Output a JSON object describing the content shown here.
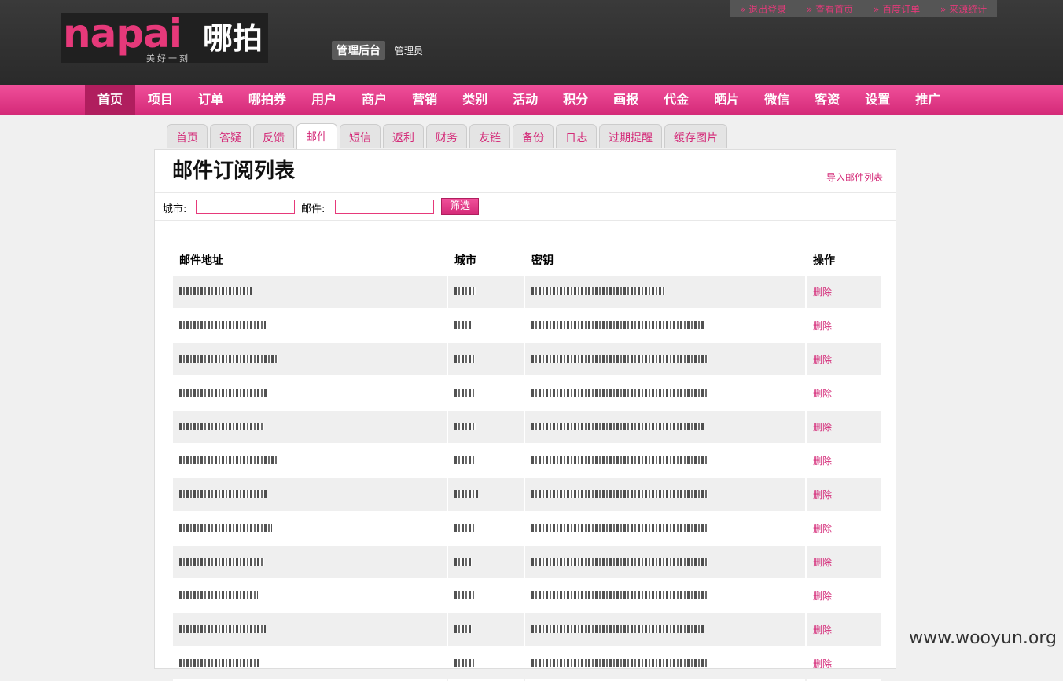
{
  "logo": {
    "text": "napai",
    "cn": "哪拍",
    "slogan": "美好一刻"
  },
  "header": {
    "badge": "管理后台",
    "user": "管理员"
  },
  "toplinks": [
    "» 退出登录",
    "» 查看首页",
    "» 百度订单",
    "» 来源统计"
  ],
  "nav": [
    "首页",
    "项目",
    "订单",
    "哪拍券",
    "用户",
    "商户",
    "营销",
    "类别",
    "活动",
    "积分",
    "画报",
    "代金",
    "晒片",
    "微信",
    "客资",
    "设置",
    "推广"
  ],
  "nav_active": 0,
  "subtabs": [
    "首页",
    "答疑",
    "反馈",
    "邮件",
    "短信",
    "返利",
    "财务",
    "友链",
    "备份",
    "日志",
    "过期提醒",
    "缓存图片"
  ],
  "subtab_active": 3,
  "page": {
    "title": "邮件订阅列表",
    "import_link": "导入邮件列表"
  },
  "filter": {
    "city_label": "城市:",
    "email_label": "邮件:",
    "button": "筛选"
  },
  "table": {
    "headers": [
      "邮件地址",
      "城市",
      "密钥",
      "操作"
    ],
    "rows": [
      {
        "action": "删除"
      },
      {
        "action": "删除"
      },
      {
        "action": "删除"
      },
      {
        "action": "删除"
      },
      {
        "action": "删除"
      },
      {
        "action": "删除"
      },
      {
        "action": "删除"
      },
      {
        "action": "删除"
      },
      {
        "action": "删除"
      },
      {
        "action": "删除"
      },
      {
        "action": "删除"
      },
      {
        "action": "删除"
      }
    ]
  },
  "watermark": "www.wooyun.org"
}
